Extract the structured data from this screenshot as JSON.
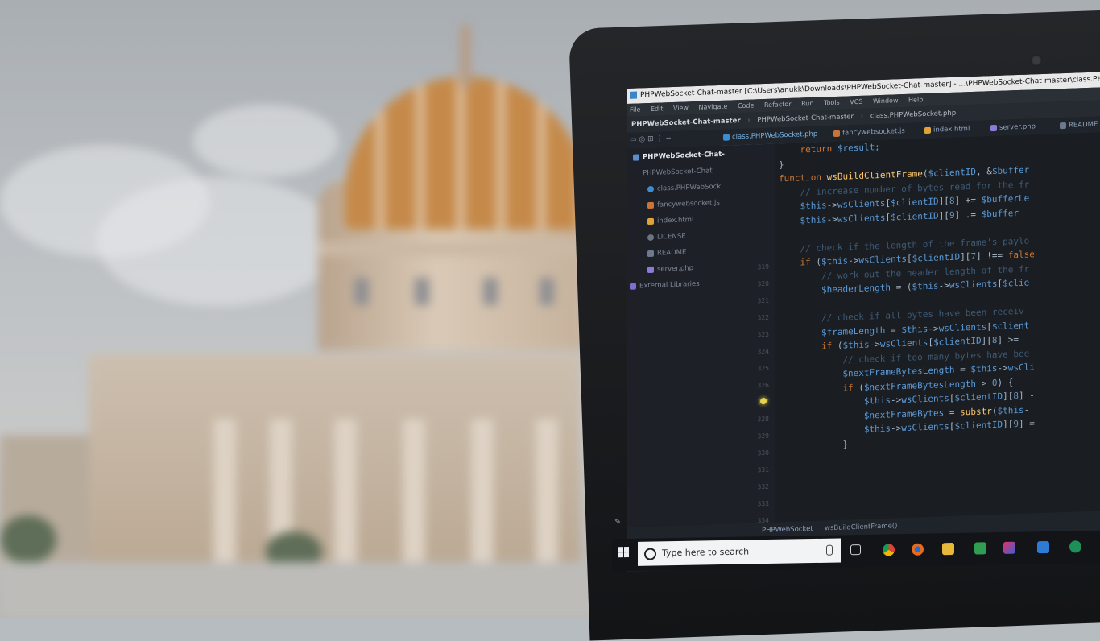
{
  "ide": {
    "title": "PHPWebSocket-Chat-master [C:\\Users\\anukk\\Downloads\\PHPWebSocket-Chat-master] - ...\\PHPWebSocket-Chat-master\\class.PHPWebSocket.php",
    "menu": [
      "File",
      "Edit",
      "View",
      "Navigate",
      "Code",
      "Refactor",
      "Run",
      "Tools",
      "VCS",
      "Window",
      "Help"
    ],
    "breadcrumb": [
      "PHPWebSocket-Chat-master",
      "PHPWebSocket-Chat-master",
      "class.PHPWebSocket.php"
    ],
    "tabs": [
      {
        "label": "class.PHPWebSocket.php",
        "color": "#3d8bd0"
      },
      {
        "label": "fancywebsocket.js",
        "color": "#c8743a"
      },
      {
        "label": "index.html",
        "color": "#e0a33a"
      },
      {
        "label": "server.php",
        "color": "#8a7bd6"
      },
      {
        "label": "README",
        "color": "#6b7a8c"
      }
    ],
    "project": {
      "root": "PHPWebSocket-Chat-",
      "folder": "PHPWebSocket-Chat",
      "files": [
        "class.PHPWebSock",
        "fancywebsocket.js",
        "index.html",
        "LICENSE",
        "README",
        "server.php"
      ],
      "external": "External Libraries"
    },
    "line_numbers": [
      "319",
      "320",
      "321",
      "322",
      "323",
      "324",
      "325",
      "326",
      "327",
      "328",
      "329",
      "330",
      "331",
      "332",
      "333",
      "334",
      "335",
      "336",
      "337",
      "338",
      "339"
    ],
    "code": [
      {
        "segments": [
          [
            "kw",
            "return "
          ],
          [
            "var",
            "$result;"
          ]
        ],
        "indent": 2
      },
      {
        "segments": [
          [
            "op",
            "}"
          ]
        ],
        "indent": 0
      },
      {
        "segments": [
          [
            "kw",
            "function "
          ],
          [
            "fn",
            "wsBuildClientFrame"
          ],
          [
            "op",
            "("
          ],
          [
            "var",
            "$clientID"
          ],
          [
            "op",
            ", &"
          ],
          [
            "var",
            "$buffer"
          ]
        ],
        "indent": 0
      },
      {
        "segments": [
          [
            "cm",
            "// increase number of bytes read for the fr"
          ]
        ],
        "indent": 2
      },
      {
        "segments": [
          [
            "var",
            "$this"
          ],
          [
            "op",
            "->"
          ],
          [
            "var",
            "wsClients"
          ],
          [
            "op",
            "["
          ],
          [
            "var",
            "$clientID"
          ],
          [
            "op",
            "]["
          ],
          [
            "nm",
            "8"
          ],
          [
            "op",
            "] += "
          ],
          [
            "var",
            "$bufferLe"
          ]
        ],
        "indent": 2
      },
      {
        "segments": [
          [
            "var",
            "$this"
          ],
          [
            "op",
            "->"
          ],
          [
            "var",
            "wsClients"
          ],
          [
            "op",
            "["
          ],
          [
            "var",
            "$clientID"
          ],
          [
            "op",
            "]["
          ],
          [
            "nm",
            "9"
          ],
          [
            "op",
            "] .= "
          ],
          [
            "var",
            "$buffer"
          ]
        ],
        "indent": 2
      },
      {
        "segments": [],
        "indent": 0
      },
      {
        "segments": [
          [
            "cm",
            "// check if the length of the frame's paylo"
          ]
        ],
        "indent": 2
      },
      {
        "segments": [
          [
            "kw",
            "if "
          ],
          [
            "op",
            "("
          ],
          [
            "var",
            "$this"
          ],
          [
            "op",
            "->"
          ],
          [
            "var",
            "wsClients"
          ],
          [
            "op",
            "["
          ],
          [
            "var",
            "$clientID"
          ],
          [
            "op",
            "]["
          ],
          [
            "nm",
            "7"
          ],
          [
            "op",
            "] !== "
          ],
          [
            "kw",
            "false"
          ]
        ],
        "indent": 2
      },
      {
        "segments": [
          [
            "cm",
            "// work out the header length of the fr"
          ]
        ],
        "indent": 4
      },
      {
        "segments": [
          [
            "var",
            "$headerLength"
          ],
          [
            "op",
            " = ("
          ],
          [
            "var",
            "$this"
          ],
          [
            "op",
            "->"
          ],
          [
            "var",
            "wsClients"
          ],
          [
            "op",
            "["
          ],
          [
            "var",
            "$clie"
          ]
        ],
        "indent": 4
      },
      {
        "segments": [],
        "indent": 0
      },
      {
        "segments": [
          [
            "cm",
            "// check if all bytes have been receiv"
          ]
        ],
        "indent": 4
      },
      {
        "segments": [
          [
            "var",
            "$frameLength"
          ],
          [
            "op",
            " = "
          ],
          [
            "var",
            "$this"
          ],
          [
            "op",
            "->"
          ],
          [
            "var",
            "wsClients"
          ],
          [
            "op",
            "["
          ],
          [
            "var",
            "$client"
          ]
        ],
        "indent": 4
      },
      {
        "segments": [
          [
            "kw",
            "if "
          ],
          [
            "op",
            "("
          ],
          [
            "var",
            "$this"
          ],
          [
            "op",
            "->"
          ],
          [
            "var",
            "wsClients"
          ],
          [
            "op",
            "["
          ],
          [
            "var",
            "$clientID"
          ],
          [
            "op",
            "]["
          ],
          [
            "nm",
            "8"
          ],
          [
            "op",
            "] >="
          ]
        ],
        "indent": 4
      },
      {
        "segments": [
          [
            "cm",
            "// check if too many bytes have bee"
          ]
        ],
        "indent": 6
      },
      {
        "segments": [
          [
            "var",
            "$nextFrameBytesLength"
          ],
          [
            "op",
            " = "
          ],
          [
            "var",
            "$this"
          ],
          [
            "op",
            "->"
          ],
          [
            "var",
            "wsCli"
          ]
        ],
        "indent": 6
      },
      {
        "segments": [
          [
            "kw",
            "if "
          ],
          [
            "op",
            "("
          ],
          [
            "var",
            "$nextFrameBytesLength"
          ],
          [
            "op",
            " > "
          ],
          [
            "nm",
            "0"
          ],
          [
            "op",
            ") {"
          ]
        ],
        "indent": 6
      },
      {
        "segments": [
          [
            "var",
            "$this"
          ],
          [
            "op",
            "->"
          ],
          [
            "var",
            "wsClients"
          ],
          [
            "op",
            "["
          ],
          [
            "var",
            "$clientID"
          ],
          [
            "op",
            "]["
          ],
          [
            "nm",
            "8"
          ],
          [
            "op",
            "] -"
          ]
        ],
        "indent": 8
      },
      {
        "segments": [
          [
            "var",
            "$nextFrameBytes"
          ],
          [
            "op",
            " = "
          ],
          [
            "fn",
            "substr"
          ],
          [
            "op",
            "("
          ],
          [
            "var",
            "$this"
          ],
          [
            "op",
            "-"
          ]
        ],
        "indent": 8
      },
      {
        "segments": [
          [
            "var",
            "$this"
          ],
          [
            "op",
            "->"
          ],
          [
            "var",
            "wsClients"
          ],
          [
            "op",
            "["
          ],
          [
            "var",
            "$clientID"
          ],
          [
            "op",
            "]["
          ],
          [
            "nm",
            "9"
          ],
          [
            "op",
            "] ="
          ]
        ],
        "indent": 8
      },
      {
        "segments": [
          [
            "op",
            "}"
          ]
        ],
        "indent": 6
      }
    ],
    "status_crumbs": [
      "PHPWebSocket",
      "wsBuildClientFrame()"
    ]
  },
  "taskbar": {
    "search_placeholder": "Type here to search",
    "apps": [
      "task-view-icon",
      "chrome-icon",
      "firefox-icon",
      "file-explorer-icon",
      "store-icon",
      "intellij-icon",
      "documents-icon",
      "sync-icon"
    ]
  }
}
